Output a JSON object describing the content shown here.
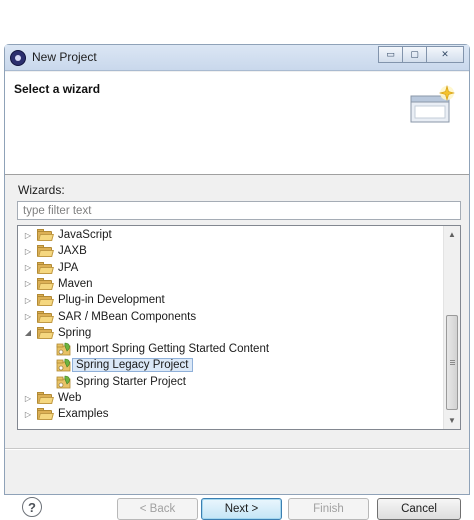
{
  "window": {
    "title": "New Project",
    "controls": {
      "minimize": "▭",
      "maximize": "▢",
      "close": "✕"
    }
  },
  "header": {
    "title": "Select a wizard",
    "banner_icon": "wizard-banner-icon"
  },
  "wizards": {
    "label": "Wizards:",
    "filter_placeholder": "type filter text",
    "filter_value": ""
  },
  "tree": {
    "items": [
      {
        "label": "JavaScript",
        "type": "folder",
        "expanded": false
      },
      {
        "label": "JAXB",
        "type": "folder",
        "expanded": false
      },
      {
        "label": "JPA",
        "type": "folder",
        "expanded": false
      },
      {
        "label": "Maven",
        "type": "folder",
        "expanded": false
      },
      {
        "label": "Plug-in Development",
        "type": "folder",
        "expanded": false
      },
      {
        "label": "SAR / MBean Components",
        "type": "folder",
        "expanded": false
      },
      {
        "label": "Spring",
        "type": "folder",
        "expanded": true
      },
      {
        "label": "Import Spring Getting Started Content",
        "type": "spring",
        "child": true
      },
      {
        "label": "Spring Legacy Project",
        "type": "spring",
        "child": true,
        "selected": true
      },
      {
        "label": "Spring Starter Project",
        "type": "spring",
        "child": true
      },
      {
        "label": "Web",
        "type": "folder",
        "expanded": false
      },
      {
        "label": "Examples",
        "type": "folder",
        "expanded": false
      }
    ]
  },
  "buttons": {
    "help": "?",
    "back": "< Back",
    "next": "Next >",
    "finish": "Finish",
    "cancel": "Cancel"
  },
  "colors": {
    "selection_fill": "#dbe8f7",
    "folder": "#dcb055",
    "spring_leaf": "#6db33f"
  }
}
